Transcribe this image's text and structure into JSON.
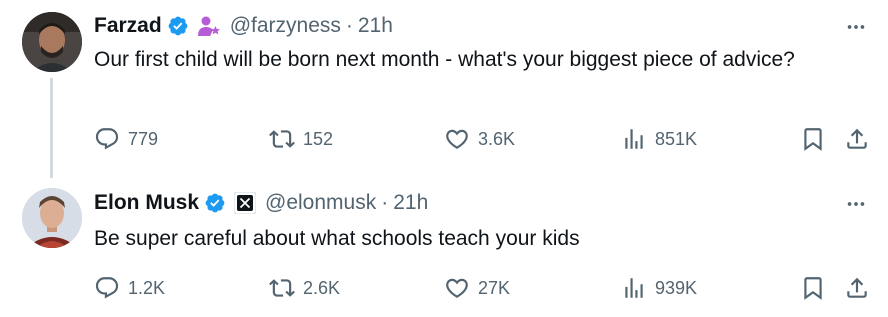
{
  "tweets": [
    {
      "author": {
        "name": "Farzad",
        "handle": "@farzyness",
        "verified": true,
        "badge": "person-star-badge"
      },
      "separator": "·",
      "time": "21h",
      "text": "Our first child will be born next month - what's your biggest piece of advice?",
      "metrics": {
        "replies": "779",
        "reposts": "152",
        "likes": "3.6K",
        "views": "851K"
      }
    },
    {
      "author": {
        "name": "Elon Musk",
        "handle": "@elonmusk",
        "verified": true,
        "badge": "x-logo-badge"
      },
      "separator": "·",
      "time": "21h",
      "text": "Be super careful about what schools teach your kids",
      "metrics": {
        "replies": "1.2K",
        "reposts": "2.6K",
        "likes": "27K",
        "views": "939K"
      }
    }
  ],
  "colors": {
    "text": "#0f1419",
    "muted": "#536471",
    "verified": "#1d9bf0",
    "badge_purple": "#b65cd6",
    "thread_line": "#cfd9de"
  },
  "icons": [
    "verified-icon",
    "more-icon",
    "reply-icon",
    "repost-icon",
    "like-icon",
    "views-icon",
    "bookmark-icon",
    "share-icon"
  ]
}
